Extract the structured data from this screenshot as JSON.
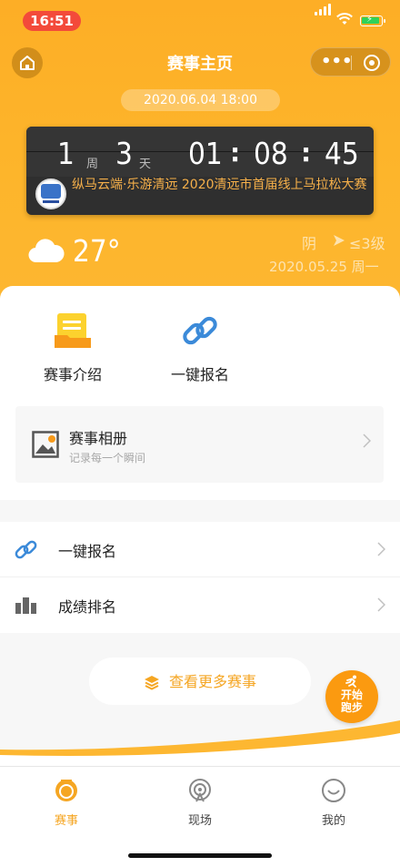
{
  "status_bar": {
    "time": "16:51"
  },
  "nav": {
    "title": "赛事主页"
  },
  "event": {
    "datetime": "2020.06.04 18:00",
    "countdown": {
      "weeks": "1",
      "weeks_unit": "周",
      "days": "3",
      "days_unit": "天",
      "hours": "01",
      "minutes": "08",
      "seconds": "45"
    },
    "race_name": "纵马云端·乐游清远 2020清远市首届线上马拉松大赛"
  },
  "weather": {
    "temperature": "27°",
    "condition": "阴",
    "wind": "≤3级",
    "date": "2020.05.25 周一"
  },
  "quick_actions": [
    {
      "label": "赛事介绍",
      "icon": "document-folder-icon"
    },
    {
      "label": "一键报名",
      "icon": "link-icon"
    }
  ],
  "album": {
    "title": "赛事相册",
    "subtitle": "记录每一个瞬间"
  },
  "list": [
    {
      "label": "一键报名",
      "icon": "link-icon"
    },
    {
      "label": "成绩排名",
      "icon": "bar-chart-icon"
    }
  ],
  "more_events": {
    "label": "查看更多赛事"
  },
  "start_run": {
    "label": "开始跑步"
  },
  "tabs": [
    {
      "label": "赛事",
      "icon": "medal-icon",
      "active": true
    },
    {
      "label": "现场",
      "icon": "broadcast-icon",
      "active": false
    },
    {
      "label": "我的",
      "icon": "smile-icon",
      "active": false
    }
  ],
  "colors": {
    "accent": "#fdae26",
    "start_button": "#fb9a10",
    "status_time": "#f34a3a"
  }
}
